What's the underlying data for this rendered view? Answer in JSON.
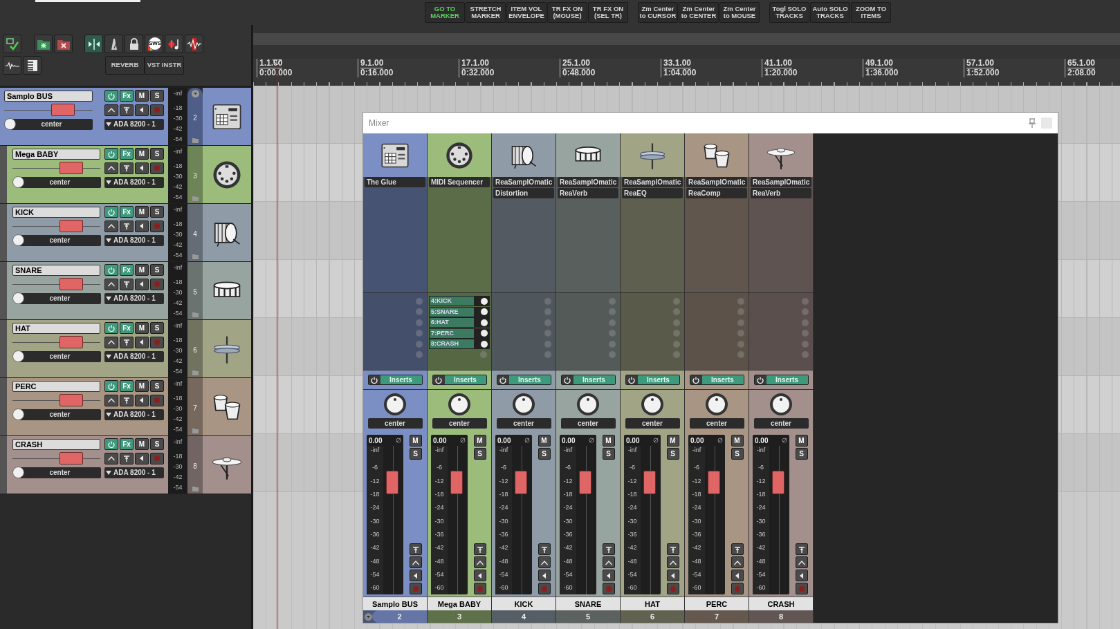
{
  "toolbar": {
    "groups": [
      [
        {
          "lines": [
            "GO TO",
            "MARKER"
          ],
          "active": true
        },
        {
          "lines": [
            "STRETCH",
            "MARKER"
          ],
          "active": false
        },
        {
          "lines": [
            "ITEM VOL",
            "ENVELOPE"
          ],
          "active": false
        },
        {
          "lines": [
            "TR FX ON",
            "(MOUSE)"
          ],
          "active": false
        },
        {
          "lines": [
            "TR FX ON",
            "(SEL TR)"
          ],
          "active": false
        }
      ],
      [
        {
          "lines": [
            "Zm Center",
            "to CURSOR"
          ],
          "active": false
        },
        {
          "lines": [
            "Zm Center",
            "to CENTER"
          ],
          "active": false
        },
        {
          "lines": [
            "Zm Center",
            "to MOUSE"
          ],
          "active": false
        }
      ],
      [
        {
          "lines": [
            "Togl SOLO",
            "TRACKS"
          ],
          "active": false
        },
        {
          "lines": [
            "Auto SOLO",
            "TRACKS"
          ],
          "active": false
        },
        {
          "lines": [
            "ZOOM TO",
            "ITEMS"
          ],
          "active": false
        }
      ]
    ]
  },
  "tools": {
    "icons": [
      {
        "kind": "monitor",
        "on": false
      },
      {
        "kind": "folder-add",
        "on": false
      },
      {
        "kind": "folder-delete",
        "on": false
      },
      {
        "kind": "ripple",
        "on": true
      },
      {
        "kind": "metronome",
        "on": false
      },
      {
        "kind": "lock",
        "on": false
      },
      {
        "kind": "sws",
        "on": false,
        "label": "SWS"
      },
      {
        "kind": "midi-note",
        "on": false
      },
      {
        "kind": "wave-red",
        "on": false
      },
      {
        "kind": "wave",
        "on": false
      },
      {
        "kind": "piano",
        "on": false
      }
    ],
    "buttons": [
      "REVERB",
      "VST INSTR"
    ]
  },
  "ruler": [
    {
      "bar": "1.1.00",
      "time": "0:00.000"
    },
    {
      "bar": "9.1.00",
      "time": "0:16.000"
    },
    {
      "bar": "17.1.00",
      "time": "0:32.000"
    },
    {
      "bar": "25.1.00",
      "time": "0:48.000"
    },
    {
      "bar": "33.1.00",
      "time": "1:04.000"
    },
    {
      "bar": "41.1.00",
      "time": "1:20.000"
    },
    {
      "bar": "49.1.00",
      "time": "1:36.000"
    },
    {
      "bar": "57.1.00",
      "time": "1:52.000"
    },
    {
      "bar": "65.1.00",
      "time": "2:08.00"
    }
  ],
  "tracks": [
    {
      "name": "Samplo BUS",
      "number": "2",
      "color": "#7b8fc4",
      "selected": true,
      "pan": "center",
      "output": "ADA 8200 - 1",
      "fx_label": "Fx",
      "mute_label": "M",
      "solo_label": "S",
      "meter_scale": [
        "-inf",
        "-18",
        "-30",
        "-42",
        "-54"
      ],
      "fader": {
        "level": 0.72
      },
      "children": [
        {
          "name": "Mega BABY",
          "number": "3",
          "color": "#9cbc7c",
          "selected": false,
          "pan": "center",
          "output": "ADA 8200 - 1",
          "fx_label": "Fx",
          "mute_label": "M",
          "solo_label": "S",
          "meter_scale": [
            "-inf",
            "-18",
            "-30",
            "-42",
            "-54"
          ],
          "fader": {
            "level": 0.72
          }
        },
        {
          "name": "KICK",
          "number": "4",
          "color": "#8f9ca8",
          "selected": false,
          "pan": "center",
          "output": "ADA 8200 - 1",
          "fx_label": "Fx",
          "mute_label": "M",
          "solo_label": "S",
          "meter_scale": [
            "-inf",
            "-18",
            "-30",
            "-42",
            "-54"
          ],
          "fader": {
            "level": 0.72
          }
        },
        {
          "name": "SNARE",
          "number": "5",
          "color": "#98a49f",
          "selected": false,
          "pan": "center",
          "output": "ADA 8200 - 1",
          "fx_label": "Fx",
          "mute_label": "M",
          "solo_label": "S",
          "meter_scale": [
            "-inf",
            "-18",
            "-30",
            "-42",
            "-54"
          ],
          "fader": {
            "level": 0.72
          }
        },
        {
          "name": "HAT",
          "number": "6",
          "color": "#a2a486",
          "selected": false,
          "pan": "center",
          "output": "ADA 8200 - 1",
          "fx_label": "Fx",
          "mute_label": "M",
          "solo_label": "S",
          "meter_scale": [
            "-inf",
            "-18",
            "-30",
            "-42",
            "-54"
          ],
          "fader": {
            "level": 0.72
          }
        },
        {
          "name": "PERC",
          "number": "7",
          "color": "#a89584",
          "selected": false,
          "pan": "center",
          "output": "ADA 8200 - 1",
          "fx_label": "Fx",
          "mute_label": "M",
          "solo_label": "S",
          "meter_scale": [
            "-inf",
            "-18",
            "-30",
            "-42",
            "-54"
          ],
          "fader": {
            "level": 0.72
          }
        },
        {
          "name": "CRASH",
          "number": "8",
          "color": "#a38f8c",
          "selected": false,
          "pan": "center",
          "output": "ADA 8200 - 1",
          "fx_label": "Fx",
          "mute_label": "M",
          "solo_label": "S",
          "meter_scale": [
            "-inf",
            "-18",
            "-30",
            "-42",
            "-54"
          ],
          "fader": {
            "level": 0.72
          }
        }
      ]
    }
  ],
  "mixer": {
    "title": "Mixer",
    "strips": [
      {
        "name": "Samplo BUS",
        "number": "2",
        "color": "#7b8fc4",
        "selected": true,
        "fx": [
          "The Glue"
        ],
        "inserts_label": "Inserts",
        "pan": "center",
        "volume": "0.00",
        "mute_label": "M",
        "solo_label": "S",
        "scale": [
          "-inf",
          "-6",
          "-12",
          "-18",
          "-24",
          "-30",
          "-36",
          "-42",
          "-48",
          "-54",
          "-60"
        ],
        "fader": {
          "level": 0.8
        }
      },
      {
        "name": "Mega BABY",
        "number": "3",
        "color": "#9cbc7c",
        "selected": false,
        "fx": [
          "MIDI Sequencer"
        ],
        "sends": [
          "4:KICK",
          "5:SNARE",
          "6:HAT",
          "7:PERC",
          "8:CRASH"
        ],
        "inserts_label": "Inserts",
        "pan": "center",
        "volume": "0.00",
        "mute_label": "M",
        "solo_label": "S",
        "scale": [
          "-inf",
          "-6",
          "-12",
          "-18",
          "-24",
          "-30",
          "-36",
          "-42",
          "-48",
          "-54",
          "-60"
        ],
        "fader": {
          "level": 0.8
        }
      },
      {
        "name": "KICK",
        "number": "4",
        "color": "#8f9ca8",
        "selected": false,
        "fx": [
          "ReaSamplOmatic",
          "Distortion"
        ],
        "inserts_label": "Inserts",
        "pan": "center",
        "volume": "0.00",
        "mute_label": "M",
        "solo_label": "S",
        "scale": [
          "-inf",
          "-6",
          "-12",
          "-18",
          "-24",
          "-30",
          "-36",
          "-42",
          "-48",
          "-54",
          "-60"
        ],
        "fader": {
          "level": 0.8
        }
      },
      {
        "name": "SNARE",
        "number": "5",
        "color": "#98a49f",
        "selected": false,
        "fx": [
          "ReaSamplOmatic",
          "ReaVerb"
        ],
        "inserts_label": "Inserts",
        "pan": "center",
        "volume": "0.00",
        "mute_label": "M",
        "solo_label": "S",
        "scale": [
          "-inf",
          "-6",
          "-12",
          "-18",
          "-24",
          "-30",
          "-36",
          "-42",
          "-48",
          "-54",
          "-60"
        ],
        "fader": {
          "level": 0.8
        }
      },
      {
        "name": "HAT",
        "number": "6",
        "color": "#a2a486",
        "selected": false,
        "fx": [
          "ReaSamplOmatic",
          "ReaEQ"
        ],
        "inserts_label": "Inserts",
        "pan": "center",
        "volume": "0.00",
        "mute_label": "M",
        "solo_label": "S",
        "scale": [
          "-inf",
          "-6",
          "-12",
          "-18",
          "-24",
          "-30",
          "-36",
          "-42",
          "-48",
          "-54",
          "-60"
        ],
        "fader": {
          "level": 0.8
        }
      },
      {
        "name": "PERC",
        "number": "7",
        "color": "#a89584",
        "selected": false,
        "fx": [
          "ReaSamplOmatic",
          "ReaComp"
        ],
        "inserts_label": "Inserts",
        "pan": "center",
        "volume": "0.00",
        "mute_label": "M",
        "solo_label": "S",
        "scale": [
          "-inf",
          "-6",
          "-12",
          "-18",
          "-24",
          "-30",
          "-36",
          "-42",
          "-48",
          "-54",
          "-60"
        ],
        "fader": {
          "level": 0.8
        }
      },
      {
        "name": "CRASH",
        "number": "8",
        "color": "#a38f8c",
        "selected": false,
        "fx": [
          "ReaSamplOmatic",
          "ReaVerb"
        ],
        "inserts_label": "Inserts",
        "pan": "center",
        "volume": "0.00",
        "mute_label": "M",
        "solo_label": "S",
        "scale": [
          "-inf",
          "-6",
          "-12",
          "-18",
          "-24",
          "-30",
          "-36",
          "-42",
          "-48",
          "-54",
          "-60"
        ],
        "fader": {
          "level": 0.8
        }
      }
    ]
  }
}
